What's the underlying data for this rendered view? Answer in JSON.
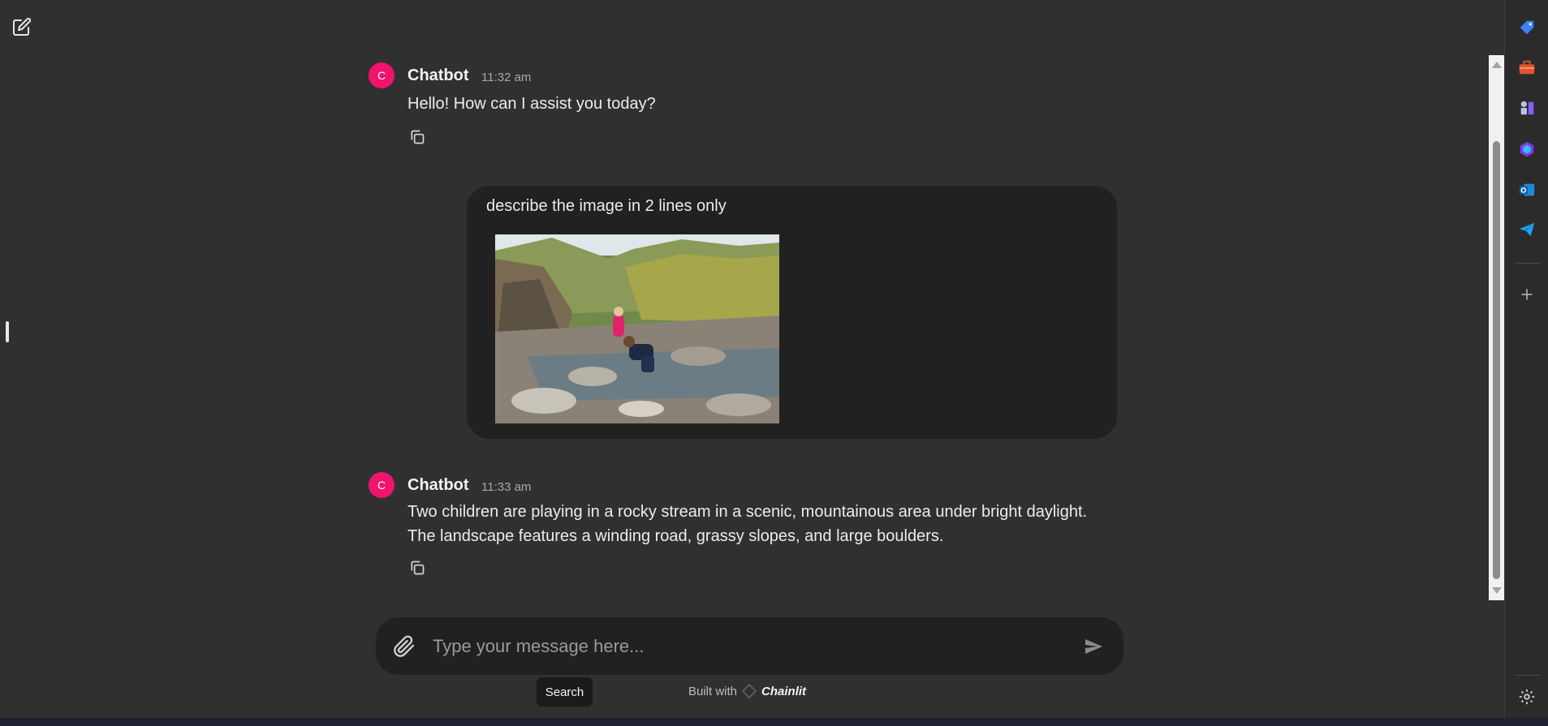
{
  "header": {
    "new_chat_icon": "edit-square-icon"
  },
  "messages": [
    {
      "author": "Chatbot",
      "avatar_letter": "C",
      "time": "11:32 am",
      "text": "Hello! How can I assist you today?"
    },
    {
      "role": "user",
      "text": "describe the image in 2 lines only",
      "image_alt": "Two children playing in a rocky mountain stream"
    },
    {
      "author": "Chatbot",
      "avatar_letter": "C",
      "time": "11:33 am",
      "text": "Two children are playing in a rocky stream in a scenic, mountainous area under bright daylight. The landscape features a winding road, grassy slopes, and large boulders."
    }
  ],
  "composer": {
    "placeholder": "Type your message here...",
    "attach_icon": "paperclip-icon",
    "send_icon": "send-icon"
  },
  "tooltip": "Search",
  "footer": {
    "built_with": "Built with",
    "brand": "Chainlit"
  },
  "edge_bar": {
    "icons": [
      "tag-icon",
      "toolbox-icon",
      "chess-icon",
      "copilot-icon",
      "outlook-icon",
      "send-plane-icon",
      "plus-icon",
      "gear-icon"
    ]
  },
  "colors": {
    "background": "#303030",
    "bubble": "#212121",
    "avatar": "#f0146c",
    "text": "#ececec"
  }
}
